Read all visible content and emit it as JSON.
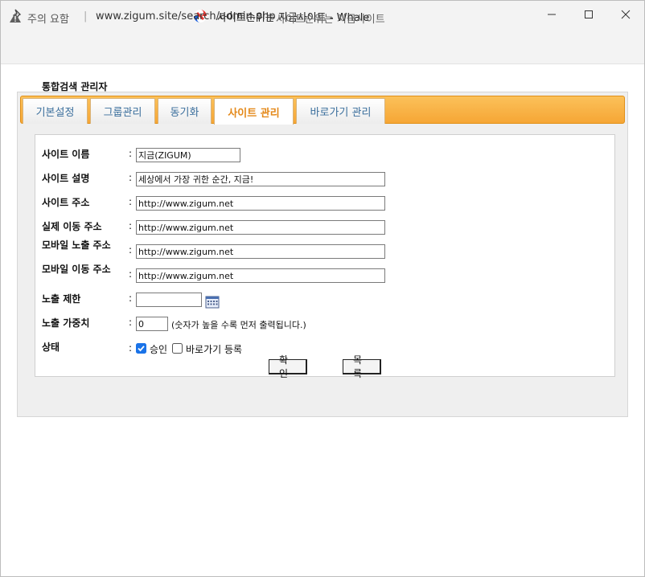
{
  "window": {
    "title": "사이트순위는 지금사이트 - Whale",
    "icons": [
      "pin-icon",
      "whale-logo-icon",
      "minimize-icon",
      "maximize-icon",
      "close-icon"
    ]
  },
  "addressbar": {
    "warning_text": "주의 요함",
    "separator": "|",
    "url": "www.zigum.site/search/admin.php",
    "page_title": "사이트순위는 지금사이트"
  },
  "page": {
    "heading": "통합검색 관리자"
  },
  "tabs": [
    {
      "label": "기본설정",
      "active": false
    },
    {
      "label": "그룹관리",
      "active": false
    },
    {
      "label": "동기화",
      "active": false
    },
    {
      "label": "사이트 관리",
      "active": true
    },
    {
      "label": "바로가기 관리",
      "active": false
    }
  ],
  "form": {
    "colon": ":",
    "site_name": {
      "label": "사이트 이름",
      "value": "지금(ZIGUM)"
    },
    "site_desc": {
      "label": "사이트 설명",
      "value": "세상에서 가장 귀한 순간, 지금!"
    },
    "site_url": {
      "label": "사이트 주소",
      "value": "http://www.zigum.net"
    },
    "real_url": {
      "label": "실제 이동 주소",
      "value": "http://www.zigum.net"
    },
    "mobile_display_url": {
      "label": "모바일 노출 주소",
      "value": "http://www.zigum.net"
    },
    "mobile_move_url": {
      "label": "모바일 이동 주소",
      "value": "http://www.zigum.net"
    },
    "exposure_limit": {
      "label": "노출 제한",
      "value": ""
    },
    "exposure_weight": {
      "label": "노출 가중치",
      "value": "0",
      "hint": "(숫자가 높을 수록 먼저 출력됩니다.)"
    },
    "status": {
      "label": "상태",
      "approve": {
        "label": "승인",
        "checked": true
      },
      "shortcut": {
        "label": "바로가기 등록",
        "checked": false
      }
    },
    "confirm_button": "확인",
    "list_button": "목록"
  },
  "colors": {
    "tab_accent": "#f6a635",
    "tab_active_text": "#e4891a",
    "tab_text": "#3a6e9c",
    "checkbox": "#1a73e8"
  }
}
